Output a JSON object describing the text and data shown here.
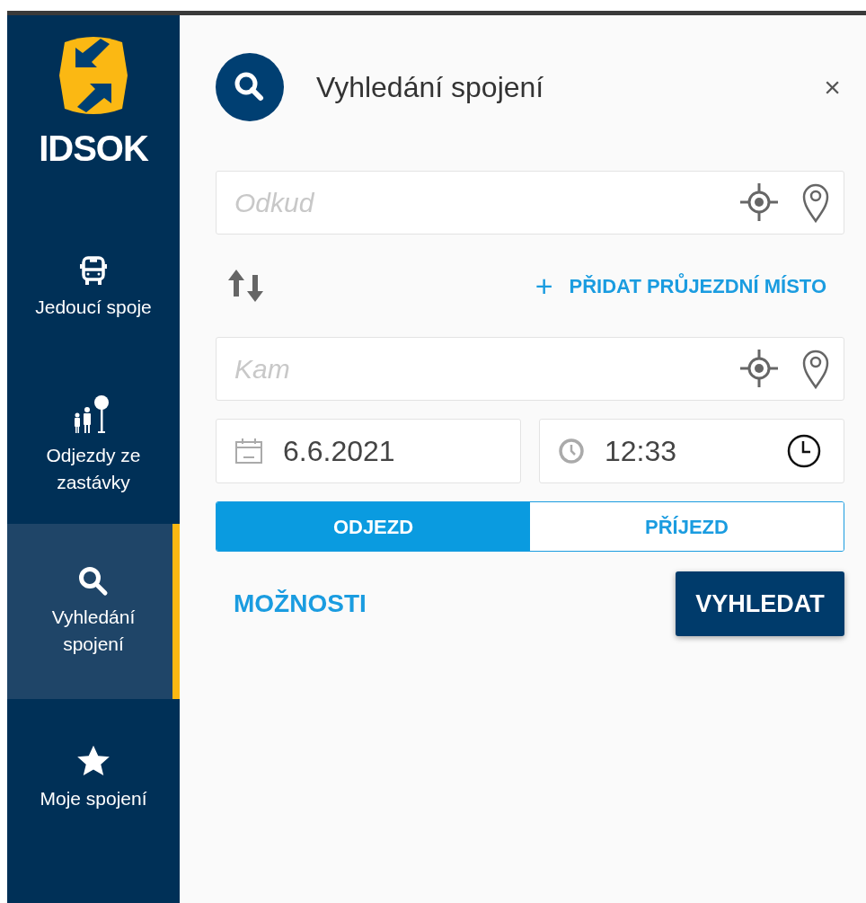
{
  "brand": {
    "name": "IDSOK"
  },
  "sidebar": {
    "items": [
      {
        "kind": "bus",
        "label": "Jedoucí spoje",
        "selected": false
      },
      {
        "kind": "stop",
        "label": "Odjezdy ze zastávky",
        "selected": false
      },
      {
        "kind": "search",
        "label": "Vyhledání spojení",
        "selected": true
      },
      {
        "kind": "star",
        "label": "Moje spojení",
        "selected": false
      }
    ]
  },
  "panel": {
    "title": "Vyhledání spojení",
    "close": "×",
    "from": {
      "placeholder": "Odkud"
    },
    "add_waypoint": {
      "icon": "+",
      "label": "PŘIDAT PRŮJEZDNÍ MÍSTO"
    },
    "to": {
      "placeholder": "Kam"
    },
    "date": {
      "value": "6.6.2021"
    },
    "time": {
      "value": "12:33"
    },
    "mode_tabs": [
      {
        "label": "ODJEZD",
        "selected": true
      },
      {
        "label": "PŘÍJEZD",
        "selected": false
      }
    ],
    "options_link": "MOŽNOSTI",
    "search_button": "VYHLEDAT"
  }
}
